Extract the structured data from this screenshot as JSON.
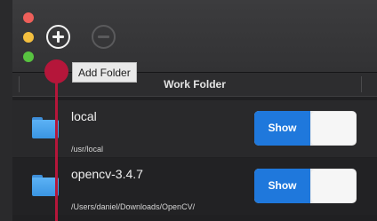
{
  "toolbar": {
    "add_button_tooltip": "Add Folder",
    "add_icon": "plus-circle-icon",
    "remove_icon": "minus-circle-icon"
  },
  "table": {
    "header": "Work Folder",
    "rows": [
      {
        "name": "local",
        "path": "/usr/local",
        "toggle_label": "Show",
        "icon": "folder-icon"
      },
      {
        "name": "opencv-3.4.7",
        "path": "/Users/daniel/Downloads/OpenCV/",
        "toggle_label": "Show",
        "icon": "folder-icon"
      }
    ]
  },
  "colors": {
    "accent": "#1f78dc",
    "pointer": "#b5163a",
    "close": "#ee5f5a",
    "minimize": "#f4bf3f",
    "maximize": "#58c340"
  }
}
